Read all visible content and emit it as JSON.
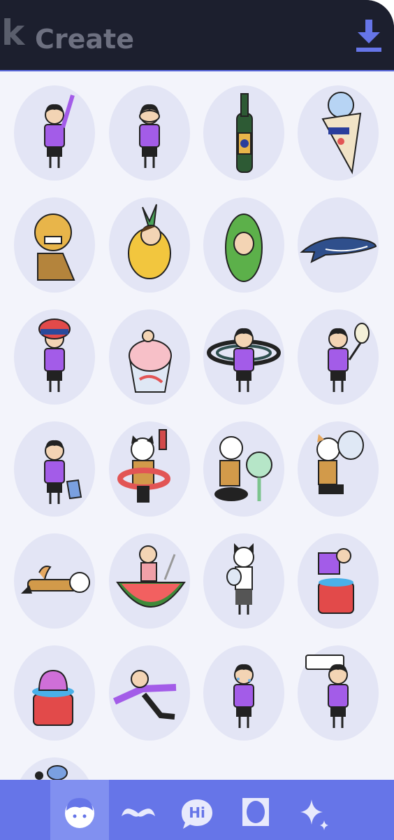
{
  "header": {
    "app_letter": "k",
    "title": "Create"
  },
  "stickers": [
    {
      "name": "girl-pointing-up",
      "row": 0,
      "col": 0
    },
    {
      "name": "girl-covering-face",
      "row": 0,
      "col": 1
    },
    {
      "name": "wine-bottle",
      "row": 0,
      "col": 2
    },
    {
      "name": "ice-cream-cone",
      "row": 0,
      "col": 3
    },
    {
      "name": "lion-dance-costume",
      "row": 1,
      "col": 0
    },
    {
      "name": "pineapple-face",
      "row": 1,
      "col": 1
    },
    {
      "name": "bitter-melon-face",
      "row": 1,
      "col": 2
    },
    {
      "name": "whale-shark",
      "row": 1,
      "col": 3
    },
    {
      "name": "girl-with-hat",
      "row": 2,
      "col": 0
    },
    {
      "name": "shaved-ice",
      "row": 2,
      "col": 1
    },
    {
      "name": "girl-in-mosquito-coil",
      "row": 2,
      "col": 2
    },
    {
      "name": "girl-with-fly-swatter",
      "row": 2,
      "col": 3
    },
    {
      "name": "girl-with-bucket",
      "row": 3,
      "col": 0
    },
    {
      "name": "dog-with-water-gun",
      "row": 3,
      "col": 1
    },
    {
      "name": "person-with-fan",
      "row": 3,
      "col": 2
    },
    {
      "name": "dog-with-hand-fan",
      "row": 3,
      "col": 3
    },
    {
      "name": "dog-lying-down",
      "row": 4,
      "col": 0
    },
    {
      "name": "man-in-watermelon",
      "row": 4,
      "col": 1
    },
    {
      "name": "cat-girl-with-fan",
      "row": 4,
      "col": 2
    },
    {
      "name": "person-splashing-water",
      "row": 4,
      "col": 3
    },
    {
      "name": "head-in-bucket",
      "row": 5,
      "col": 0
    },
    {
      "name": "person-floating",
      "row": 5,
      "col": 1
    },
    {
      "name": "sweaty-girl",
      "row": 5,
      "col": 2
    },
    {
      "name": "person-under-air-conditioner",
      "row": 5,
      "col": 3
    },
    {
      "name": "partial-sticker",
      "row": 6,
      "col": 0
    }
  ],
  "tabs": [
    {
      "name": "tab-face",
      "icon": "face-icon",
      "active": true
    },
    {
      "name": "tab-mustache",
      "icon": "mustache-icon",
      "active": false
    },
    {
      "name": "tab-text",
      "icon": "speech-bubble-icon",
      "label": "Hi",
      "active": false
    },
    {
      "name": "tab-frame",
      "icon": "frame-icon",
      "active": false
    },
    {
      "name": "tab-sparkle",
      "icon": "sparkle-icon",
      "active": false
    }
  ],
  "colors": {
    "header_bg": "#1c1f2e",
    "content_bg": "#f3f4fb",
    "oval": "#e3e5f5",
    "tabbar": "#6675e8",
    "tab_active": "#8190f0",
    "download_icon": "#6675e8",
    "purple_shirt": "#a35ce8"
  }
}
